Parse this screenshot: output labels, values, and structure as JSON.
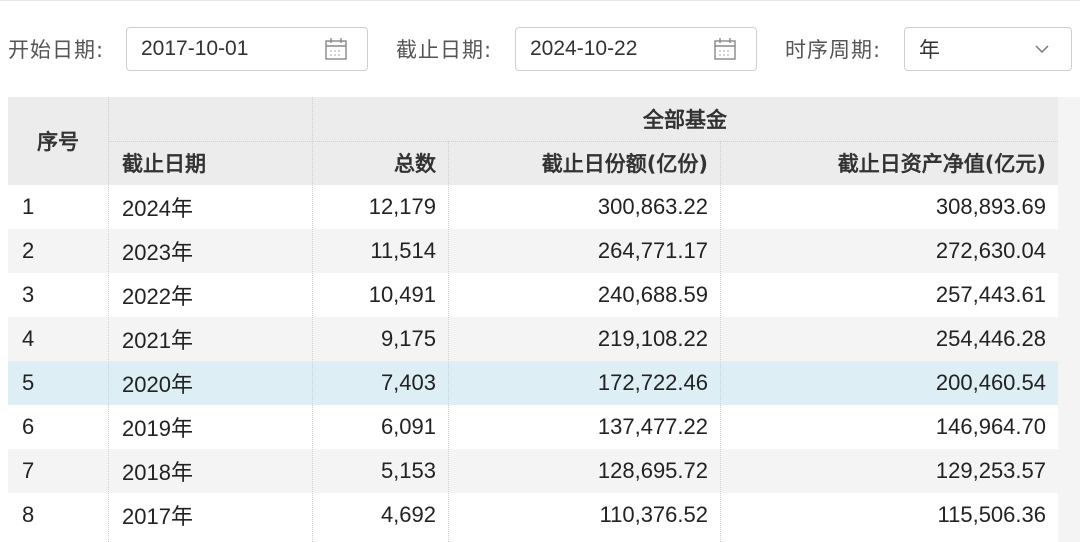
{
  "filters": {
    "start_label": "开始日期:",
    "start_value": "2017-10-01",
    "end_label": "截止日期:",
    "end_value": "2024-10-22",
    "period_label": "时序周期:",
    "period_value": "年"
  },
  "table": {
    "header": {
      "seq": "序号",
      "group": "全部基金",
      "date": "截止日期",
      "count": "总数",
      "shares": "截止日份额(亿份)",
      "nav": "截止日资产净值(亿元)"
    },
    "rows": [
      {
        "seq": "1",
        "date": "2024年",
        "count": "12,179",
        "shares": "300,863.22",
        "nav": "308,893.69"
      },
      {
        "seq": "2",
        "date": "2023年",
        "count": "11,514",
        "shares": "264,771.17",
        "nav": "272,630.04"
      },
      {
        "seq": "3",
        "date": "2022年",
        "count": "10,491",
        "shares": "240,688.59",
        "nav": "257,443.61"
      },
      {
        "seq": "4",
        "date": "2021年",
        "count": "9,175",
        "shares": "219,108.22",
        "nav": "254,446.28"
      },
      {
        "seq": "5",
        "date": "2020年",
        "count": "7,403",
        "shares": "172,722.46",
        "nav": "200,460.54"
      },
      {
        "seq": "6",
        "date": "2019年",
        "count": "6,091",
        "shares": "137,477.22",
        "nav": "146,964.70"
      },
      {
        "seq": "7",
        "date": "2018年",
        "count": "5,153",
        "shares": "128,695.72",
        "nav": "129,253.57"
      },
      {
        "seq": "8",
        "date": "2017年",
        "count": "4,692",
        "shares": "110,376.52",
        "nav": "115,506.36"
      }
    ],
    "selected_row": "5"
  },
  "icons": {
    "calendar": "calendar-icon",
    "dropdown": "chevron-down-icon"
  },
  "colors": {
    "header_bg": "#ececec",
    "row_alt_bg": "#f4f4f4",
    "row_bg": "#ffffff",
    "selected_bg": "#ddeef4"
  }
}
